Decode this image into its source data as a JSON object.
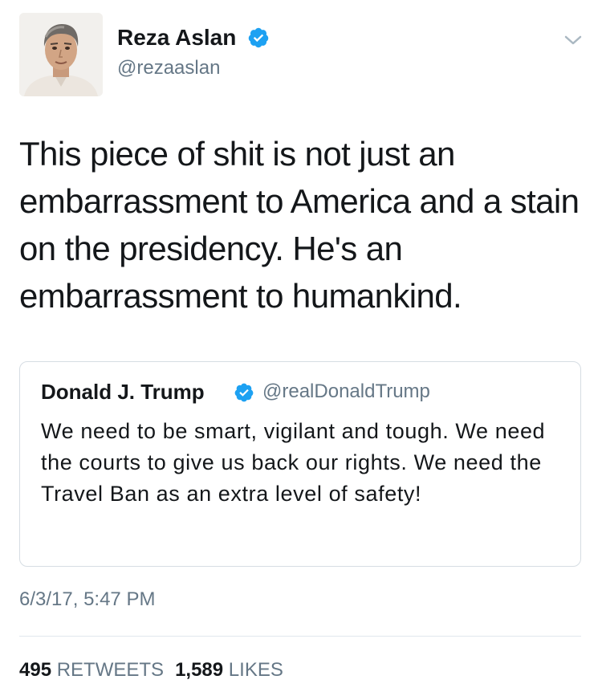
{
  "author": {
    "name": "Reza Aslan",
    "handle": "@rezaaslan",
    "verified": true,
    "avatar_icon": "avatar-photo"
  },
  "tweet": {
    "text": "This piece of shit is not just an embarrassment to America and a stain on the presidency. He's an embarrassment to humankind.",
    "timestamp": "6/3/17, 5:47 PM"
  },
  "quoted_tweet": {
    "name": "Donald J. Trump",
    "handle": "@realDonaldTrump",
    "verified": true,
    "text": "We need to be smart, vigilant and tough. We need the courts to give us back our rights. We need the Travel Ban as an extra level of safety!"
  },
  "stats": {
    "retweets_count": "495",
    "retweets_label": "RETWEETS",
    "likes_count": "1,589",
    "likes_label": "LIKES"
  },
  "icons": {
    "verified": "verified-badge-icon",
    "menu": "chevron-down-icon"
  },
  "colors": {
    "verified_blue": "#1da1f2",
    "secondary_text": "#657786",
    "primary_text": "#14171a",
    "border": "#d6dde3"
  }
}
